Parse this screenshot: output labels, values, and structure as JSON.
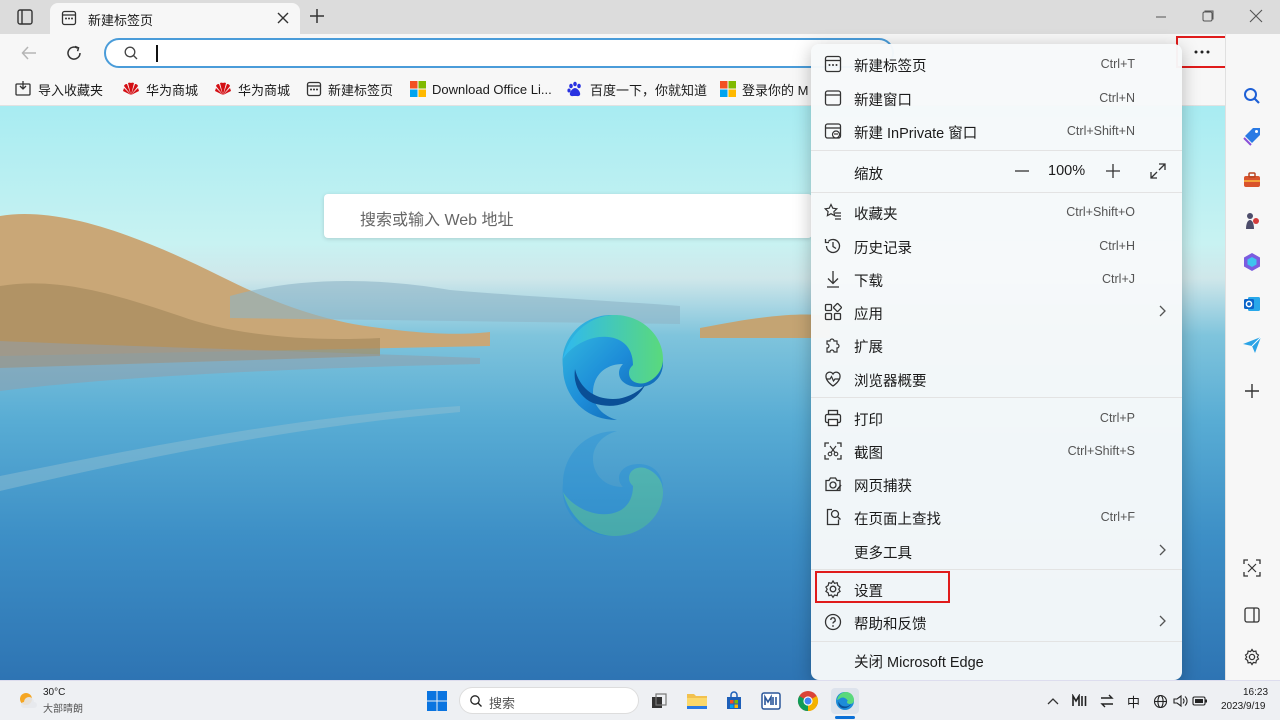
{
  "tab": {
    "title": "新建标签页"
  },
  "address": {
    "value": ""
  },
  "favorites": [
    {
      "label": "导入收藏夹"
    },
    {
      "label": "华为商城"
    },
    {
      "label": "华为商城"
    },
    {
      "label": "新建标签页"
    },
    {
      "label": "Download Office Li..."
    },
    {
      "label": "百度一下，你就知道"
    },
    {
      "label": "登录你的 M"
    }
  ],
  "newtab": {
    "search_placeholder": "搜索或输入 Web 地址"
  },
  "menu": {
    "new_tab": {
      "label": "新建标签页",
      "shortcut": "Ctrl+T"
    },
    "new_window": {
      "label": "新建窗口",
      "shortcut": "Ctrl+N"
    },
    "new_inprivate": {
      "label": "新建 InPrivate 窗口",
      "shortcut": "Ctrl+Shift+N"
    },
    "zoom": {
      "label": "缩放",
      "minus": "—",
      "value": "100%",
      "plus": "+"
    },
    "favorites": {
      "label": "收藏夹",
      "shortcut": "Ctrl+Shift+O"
    },
    "history": {
      "label": "历史记录",
      "shortcut": "Ctrl+H"
    },
    "downloads": {
      "label": "下载",
      "shortcut": "Ctrl+J"
    },
    "apps": {
      "label": "应用"
    },
    "extensions": {
      "label": "扩展"
    },
    "essentials": {
      "label": "浏览器概要"
    },
    "print": {
      "label": "打印",
      "shortcut": "Ctrl+P"
    },
    "screenshot": {
      "label": "截图",
      "shortcut": "Ctrl+Shift+S"
    },
    "web_capture": {
      "label": "网页捕获"
    },
    "find": {
      "label": "在页面上查找",
      "shortcut": "Ctrl+F"
    },
    "more_tools": {
      "label": "更多工具"
    },
    "settings": {
      "label": "设置"
    },
    "help": {
      "label": "帮助和反馈"
    },
    "close": {
      "label": "关闭 Microsoft Edge"
    }
  },
  "taskbar": {
    "weather_temp": "30°C",
    "weather_desc": "大部晴朗",
    "search_placeholder": "搜索",
    "ime": "中",
    "time": "16:23",
    "date": "2023/9/19"
  },
  "colors": {
    "highlight": "#e01b1b",
    "accent": "#0b6fd6"
  }
}
